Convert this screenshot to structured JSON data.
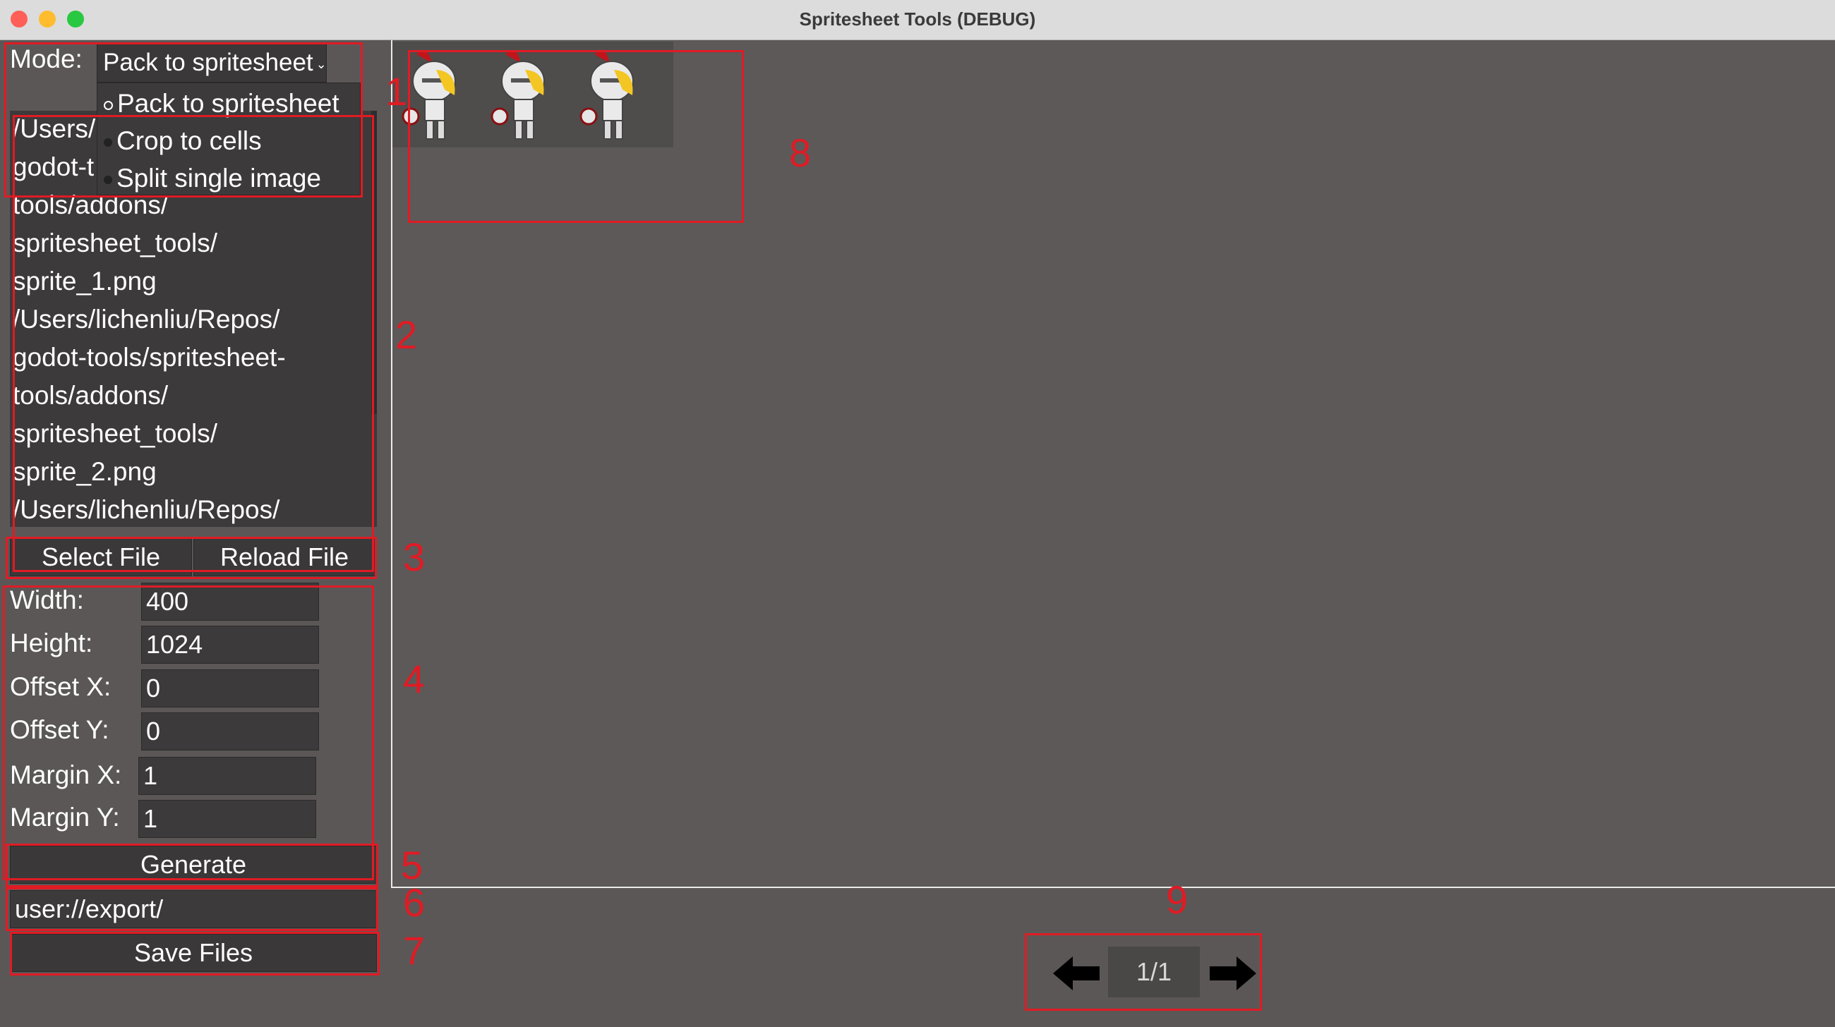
{
  "window": {
    "title": "Spritesheet Tools (DEBUG)"
  },
  "mode": {
    "label": "Mode:",
    "selected": "Pack to spritesheet",
    "options": [
      "Pack to spritesheet",
      "Crop to cells",
      "Split single image"
    ]
  },
  "files": {
    "lines": [
      "/Users/",
      "godot-t",
      "tools/addons/",
      "spritesheet_tools/",
      "sprite_1.png",
      "/Users/lichenliu/Repos/",
      "godot-tools/spritesheet-",
      "tools/addons/",
      "spritesheet_tools/",
      "sprite_2.png",
      "/Users/lichenliu/Repos/"
    ]
  },
  "buttons": {
    "select_file": "Select File",
    "reload_file": "Reload File",
    "generate": "Generate",
    "save_files": "Save Files"
  },
  "params": {
    "width": {
      "label": "Width:",
      "value": "400"
    },
    "height": {
      "label": "Height:",
      "value": "1024"
    },
    "offset_x": {
      "label": "Offset X:",
      "value": "0"
    },
    "offset_y": {
      "label": "Offset Y:",
      "value": "0"
    },
    "margin_x": {
      "label": "Margin X:",
      "value": "1"
    },
    "margin_y": {
      "label": "Margin Y:",
      "value": "1"
    }
  },
  "export_path": "user://export/",
  "pager": {
    "count": "1/1"
  },
  "annotations": [
    "1",
    "2",
    "3",
    "4",
    "5",
    "6",
    "7",
    "8",
    "9"
  ],
  "colors": {
    "annotation": "#e01b24",
    "background": "#5c5757",
    "field": "#3c3a3a"
  }
}
